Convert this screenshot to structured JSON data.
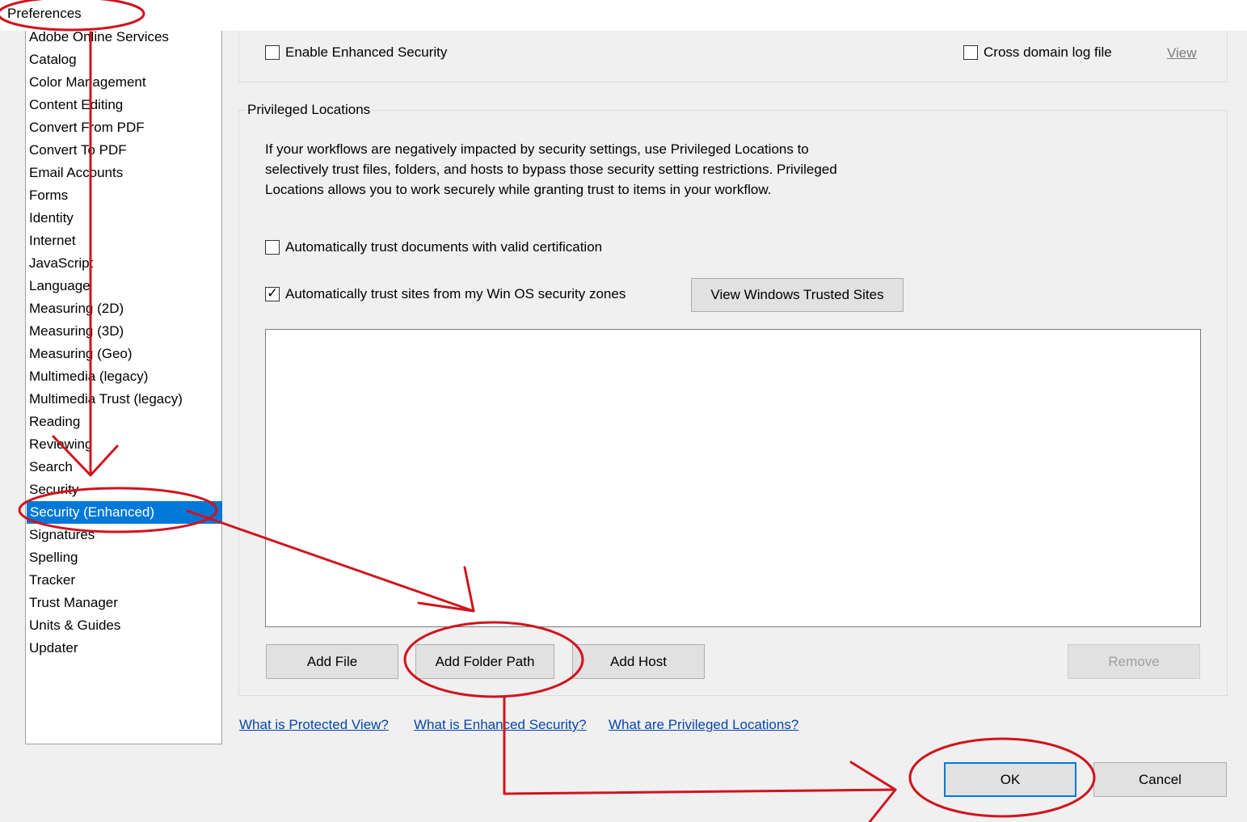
{
  "window": {
    "title": "Preferences"
  },
  "sidebar": {
    "items": [
      "Adobe Online Services",
      "Catalog",
      "Color Management",
      "Content Editing",
      "Convert From PDF",
      "Convert To PDF",
      "Email Accounts",
      "Forms",
      "Identity",
      "Internet",
      "JavaScript",
      "Language",
      "Measuring (2D)",
      "Measuring (3D)",
      "Measuring (Geo)",
      "Multimedia (legacy)",
      "Multimedia Trust (legacy)",
      "Reading",
      "Reviewing",
      "Search",
      "Security",
      "Security (Enhanced)",
      "Signatures",
      "Spelling",
      "Tracker",
      "Trust Manager",
      "Units & Guides",
      "Updater"
    ],
    "selected": "Security (Enhanced)"
  },
  "sandbox": {
    "enable_enhanced_security": {
      "label": "Enable Enhanced Security",
      "checked": false
    },
    "cross_domain_log": {
      "label": "Cross domain log file",
      "checked": false
    },
    "view_link": "View"
  },
  "privileged": {
    "title": "Privileged Locations",
    "description": "If your workflows are negatively impacted by security settings, use Privileged Locations to selectively trust files, folders, and hosts to bypass those security setting restrictions. Privileged Locations allows you to work securely while granting trust to items in your workflow.",
    "auto_trust_certified": {
      "label": "Automatically trust documents with valid certification",
      "checked": false
    },
    "auto_trust_sites": {
      "label": "Automatically trust sites from my Win OS security zones",
      "checked": true
    },
    "view_trusted_sites": "View Windows Trusted Sites",
    "buttons": {
      "add_file": "Add File",
      "add_folder_path": "Add Folder Path",
      "add_host": "Add Host",
      "remove": "Remove"
    }
  },
  "help_links": {
    "protected_view": "What is Protected View?",
    "enhanced_security": "What is Enhanced Security?",
    "privileged_locations": "What are Privileged Locations?"
  },
  "dialog_buttons": {
    "ok": "OK",
    "cancel": "Cancel"
  },
  "annotation_color": "#d0141e"
}
